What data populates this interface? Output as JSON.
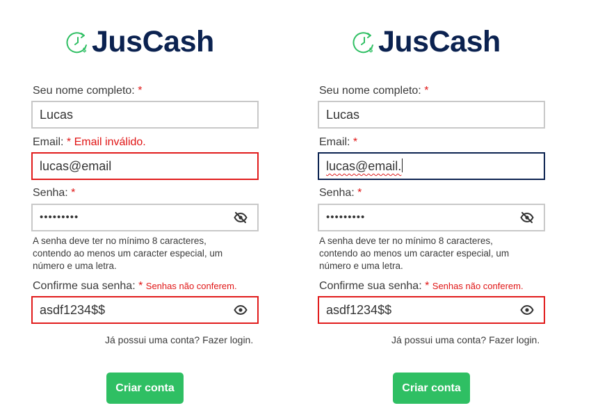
{
  "brand": {
    "name": "JusCash",
    "logo_icon": "clock-dollar-icon"
  },
  "colors": {
    "brand": "#0b2250",
    "accent_green": "#2fbf63",
    "error_red": "#e01515",
    "focus_border": "#0b2250"
  },
  "panels": [
    {
      "name_label": "Seu nome completo:",
      "name_required": "*",
      "name_value": "Lucas",
      "email_label": "Email:",
      "email_required": "*",
      "email_error": "Email inválido.",
      "email_value": "lucas@email",
      "password_label": "Senha:",
      "password_required": "*",
      "password_value": "•••••••••",
      "password_icon": "eye-slash-icon",
      "password_hint": "A senha deve ter no mínimo 8 caracteres, contendo ao menos um caracter especial, um número e uma letra.",
      "confirm_label": "Confirme sua senha:",
      "confirm_required": "*",
      "confirm_error": "Senhas não conferem.",
      "confirm_value": "asdf1234$$",
      "confirm_icon": "eye-icon",
      "login_text": "Já possui uma conta? Fazer login.",
      "submit_label": "Criar conta"
    },
    {
      "name_label": "Seu nome completo:",
      "name_required": "*",
      "name_value": "Lucas",
      "email_label": "Email:",
      "email_required": "*",
      "email_value": "lucas@email.",
      "password_label": "Senha:",
      "password_required": "*",
      "password_value": "•••••••••",
      "password_icon": "eye-slash-icon",
      "password_hint": "A senha deve ter no mínimo 8 caracteres, contendo ao menos um caracter especial, um número e uma letra.",
      "confirm_label": "Confirme sua senha:",
      "confirm_required": "*",
      "confirm_error": "Senhas não conferem.",
      "confirm_value": "asdf1234$$",
      "confirm_icon": "eye-icon",
      "login_text": "Já possui uma conta? Fazer login.",
      "submit_label": "Criar conta"
    }
  ]
}
